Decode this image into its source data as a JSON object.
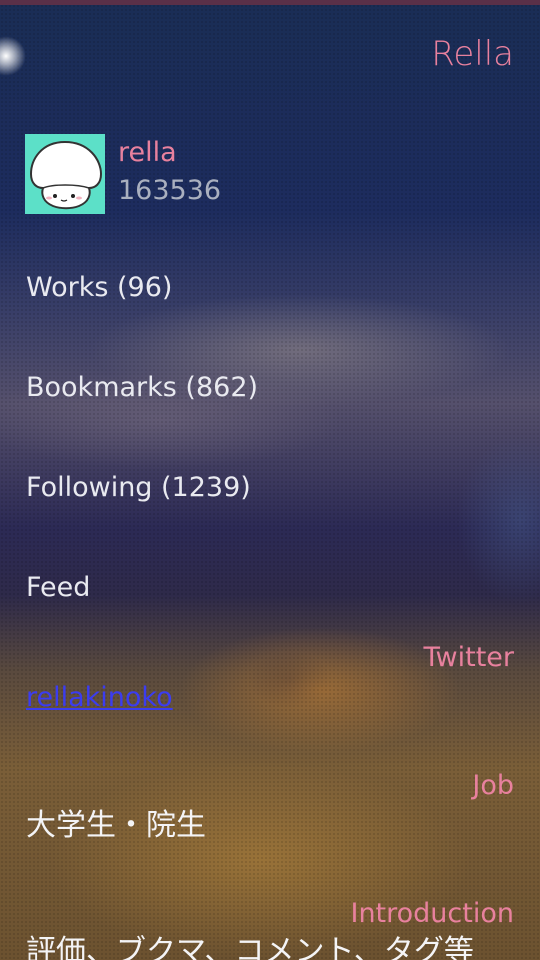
{
  "header": {
    "title": "Rella"
  },
  "profile": {
    "username": "rella",
    "user_id": "163536"
  },
  "menu": {
    "works": "Works (96)",
    "bookmarks": "Bookmarks (862)",
    "following": "Following (1239)",
    "feed": "Feed"
  },
  "twitter": {
    "label": "Twitter",
    "handle": "rellakinoko"
  },
  "job": {
    "label": "Job",
    "value": "大学生・院生"
  },
  "introduction": {
    "label": "Introduction",
    "value": "評価、ブクマ、コメント、タグ等"
  },
  "colors": {
    "accent": "#e8819e",
    "link": "#3b3cf0",
    "avatar_bg": "#5ce0c8"
  }
}
